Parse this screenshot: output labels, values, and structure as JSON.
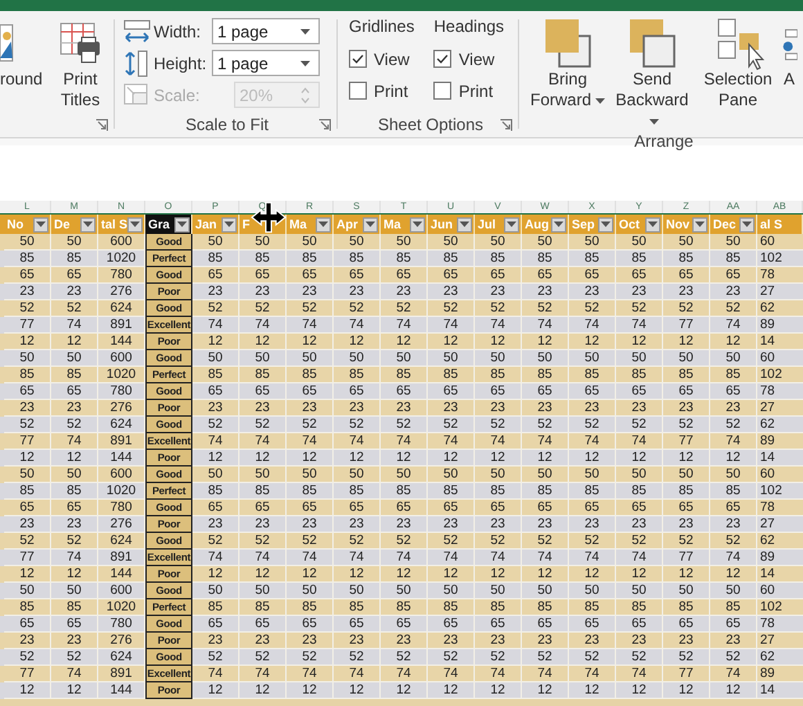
{
  "ribbon": {
    "page_setup": {
      "buttons": [
        {
          "label": "round"
        },
        {
          "label": "Print Titles"
        }
      ]
    },
    "scale_to_fit": {
      "label": "Scale to Fit",
      "fields": [
        {
          "label": "Width:",
          "value": "1 page",
          "kind": "dropdown",
          "disabled": false
        },
        {
          "label": "Height:",
          "value": "1 page",
          "kind": "dropdown",
          "disabled": false
        },
        {
          "label": "Scale:",
          "value": "20%",
          "kind": "spinner",
          "disabled": true
        }
      ]
    },
    "sheet_options": {
      "label": "Sheet Options",
      "columns": [
        {
          "heading": "Gridlines",
          "options": [
            {
              "label": "View",
              "checked": true
            },
            {
              "label": "Print",
              "checked": false
            }
          ]
        },
        {
          "heading": "Headings",
          "options": [
            {
              "label": "View",
              "checked": true
            },
            {
              "label": "Print",
              "checked": false
            }
          ]
        }
      ]
    },
    "arrange": {
      "label": "Arrange",
      "buttons": [
        {
          "label": "Bring Forward",
          "dropdown": true
        },
        {
          "label": "Send Backward",
          "dropdown": true
        },
        {
          "label": "Selection Pane",
          "dropdown": false
        },
        {
          "label": "A",
          "dropdown": false
        }
      ]
    }
  },
  "sheet": {
    "columns": [
      {
        "letter": "L",
        "header": "No",
        "kind": "number",
        "filter": true
      },
      {
        "letter": "M",
        "header": "De",
        "kind": "number",
        "filter": true
      },
      {
        "letter": "N",
        "header": "tal S",
        "kind": "number",
        "filter": true
      },
      {
        "letter": "O",
        "header": "Gra",
        "kind": "grade",
        "filter": true
      },
      {
        "letter": "P",
        "header": "Jan",
        "kind": "number",
        "filter": true
      },
      {
        "letter": "Q",
        "header": "F",
        "kind": "number",
        "filter": false
      },
      {
        "letter": "R",
        "header": "Ma",
        "kind": "number",
        "filter": true
      },
      {
        "letter": "S",
        "header": "Apr",
        "kind": "number",
        "filter": true
      },
      {
        "letter": "T",
        "header": "Ma",
        "kind": "number",
        "filter": true
      },
      {
        "letter": "U",
        "header": "Jun",
        "kind": "number",
        "filter": true
      },
      {
        "letter": "V",
        "header": "Jul",
        "kind": "number",
        "filter": true
      },
      {
        "letter": "W",
        "header": "Aug",
        "kind": "number",
        "filter": true
      },
      {
        "letter": "X",
        "header": "Sep",
        "kind": "number",
        "filter": true
      },
      {
        "letter": "Y",
        "header": "Oct",
        "kind": "number",
        "filter": true
      },
      {
        "letter": "Z",
        "header": "Nov",
        "kind": "number",
        "filter": true
      },
      {
        "letter": "AA",
        "header": "Dec",
        "kind": "number",
        "filter": true
      },
      {
        "letter": "AB",
        "header": "al S",
        "kind": "number",
        "filter": false
      }
    ],
    "rows": [
      [
        "50",
        "50",
        "600",
        "Good",
        "50",
        "50",
        "50",
        "50",
        "50",
        "50",
        "50",
        "50",
        "50",
        "50",
        "50",
        "50",
        "60"
      ],
      [
        "85",
        "85",
        "1020",
        "Perfect",
        "85",
        "85",
        "85",
        "85",
        "85",
        "85",
        "85",
        "85",
        "85",
        "85",
        "85",
        "85",
        "102"
      ],
      [
        "65",
        "65",
        "780",
        "Good",
        "65",
        "65",
        "65",
        "65",
        "65",
        "65",
        "65",
        "65",
        "65",
        "65",
        "65",
        "65",
        "78"
      ],
      [
        "23",
        "23",
        "276",
        "Poor",
        "23",
        "23",
        "23",
        "23",
        "23",
        "23",
        "23",
        "23",
        "23",
        "23",
        "23",
        "23",
        "27"
      ],
      [
        "52",
        "52",
        "624",
        "Good",
        "52",
        "52",
        "52",
        "52",
        "52",
        "52",
        "52",
        "52",
        "52",
        "52",
        "52",
        "52",
        "62"
      ],
      [
        "77",
        "74",
        "891",
        "Excellent",
        "74",
        "74",
        "74",
        "74",
        "74",
        "74",
        "74",
        "74",
        "74",
        "74",
        "77",
        "74",
        "89"
      ],
      [
        "12",
        "12",
        "144",
        "Poor",
        "12",
        "12",
        "12",
        "12",
        "12",
        "12",
        "12",
        "12",
        "12",
        "12",
        "12",
        "12",
        "14"
      ],
      [
        "50",
        "50",
        "600",
        "Good",
        "50",
        "50",
        "50",
        "50",
        "50",
        "50",
        "50",
        "50",
        "50",
        "50",
        "50",
        "50",
        "60"
      ],
      [
        "85",
        "85",
        "1020",
        "Perfect",
        "85",
        "85",
        "85",
        "85",
        "85",
        "85",
        "85",
        "85",
        "85",
        "85",
        "85",
        "85",
        "102"
      ],
      [
        "65",
        "65",
        "780",
        "Good",
        "65",
        "65",
        "65",
        "65",
        "65",
        "65",
        "65",
        "65",
        "65",
        "65",
        "65",
        "65",
        "78"
      ],
      [
        "23",
        "23",
        "276",
        "Poor",
        "23",
        "23",
        "23",
        "23",
        "23",
        "23",
        "23",
        "23",
        "23",
        "23",
        "23",
        "23",
        "27"
      ],
      [
        "52",
        "52",
        "624",
        "Good",
        "52",
        "52",
        "52",
        "52",
        "52",
        "52",
        "52",
        "52",
        "52",
        "52",
        "52",
        "52",
        "62"
      ],
      [
        "77",
        "74",
        "891",
        "Excellent",
        "74",
        "74",
        "74",
        "74",
        "74",
        "74",
        "74",
        "74",
        "74",
        "74",
        "77",
        "74",
        "89"
      ],
      [
        "12",
        "12",
        "144",
        "Poor",
        "12",
        "12",
        "12",
        "12",
        "12",
        "12",
        "12",
        "12",
        "12",
        "12",
        "12",
        "12",
        "14"
      ],
      [
        "50",
        "50",
        "600",
        "Good",
        "50",
        "50",
        "50",
        "50",
        "50",
        "50",
        "50",
        "50",
        "50",
        "50",
        "50",
        "50",
        "60"
      ],
      [
        "85",
        "85",
        "1020",
        "Perfect",
        "85",
        "85",
        "85",
        "85",
        "85",
        "85",
        "85",
        "85",
        "85",
        "85",
        "85",
        "85",
        "102"
      ],
      [
        "65",
        "65",
        "780",
        "Good",
        "65",
        "65",
        "65",
        "65",
        "65",
        "65",
        "65",
        "65",
        "65",
        "65",
        "65",
        "65",
        "78"
      ],
      [
        "23",
        "23",
        "276",
        "Poor",
        "23",
        "23",
        "23",
        "23",
        "23",
        "23",
        "23",
        "23",
        "23",
        "23",
        "23",
        "23",
        "27"
      ],
      [
        "52",
        "52",
        "624",
        "Good",
        "52",
        "52",
        "52",
        "52",
        "52",
        "52",
        "52",
        "52",
        "52",
        "52",
        "52",
        "52",
        "62"
      ],
      [
        "77",
        "74",
        "891",
        "Excellent",
        "74",
        "74",
        "74",
        "74",
        "74",
        "74",
        "74",
        "74",
        "74",
        "74",
        "77",
        "74",
        "89"
      ],
      [
        "12",
        "12",
        "144",
        "Poor",
        "12",
        "12",
        "12",
        "12",
        "12",
        "12",
        "12",
        "12",
        "12",
        "12",
        "12",
        "12",
        "14"
      ],
      [
        "50",
        "50",
        "600",
        "Good",
        "50",
        "50",
        "50",
        "50",
        "50",
        "50",
        "50",
        "50",
        "50",
        "50",
        "50",
        "50",
        "60"
      ],
      [
        "85",
        "85",
        "1020",
        "Perfect",
        "85",
        "85",
        "85",
        "85",
        "85",
        "85",
        "85",
        "85",
        "85",
        "85",
        "85",
        "85",
        "102"
      ],
      [
        "65",
        "65",
        "780",
        "Good",
        "65",
        "65",
        "65",
        "65",
        "65",
        "65",
        "65",
        "65",
        "65",
        "65",
        "65",
        "65",
        "78"
      ],
      [
        "23",
        "23",
        "276",
        "Poor",
        "23",
        "23",
        "23",
        "23",
        "23",
        "23",
        "23",
        "23",
        "23",
        "23",
        "23",
        "23",
        "27"
      ],
      [
        "52",
        "52",
        "624",
        "Good",
        "52",
        "52",
        "52",
        "52",
        "52",
        "52",
        "52",
        "52",
        "52",
        "52",
        "52",
        "52",
        "62"
      ],
      [
        "77",
        "74",
        "891",
        "Excellent",
        "74",
        "74",
        "74",
        "74",
        "74",
        "74",
        "74",
        "74",
        "74",
        "74",
        "77",
        "74",
        "89"
      ],
      [
        "12",
        "12",
        "144",
        "Poor",
        "12",
        "12",
        "12",
        "12",
        "12",
        "12",
        "12",
        "12",
        "12",
        "12",
        "12",
        "12",
        "14"
      ]
    ]
  }
}
